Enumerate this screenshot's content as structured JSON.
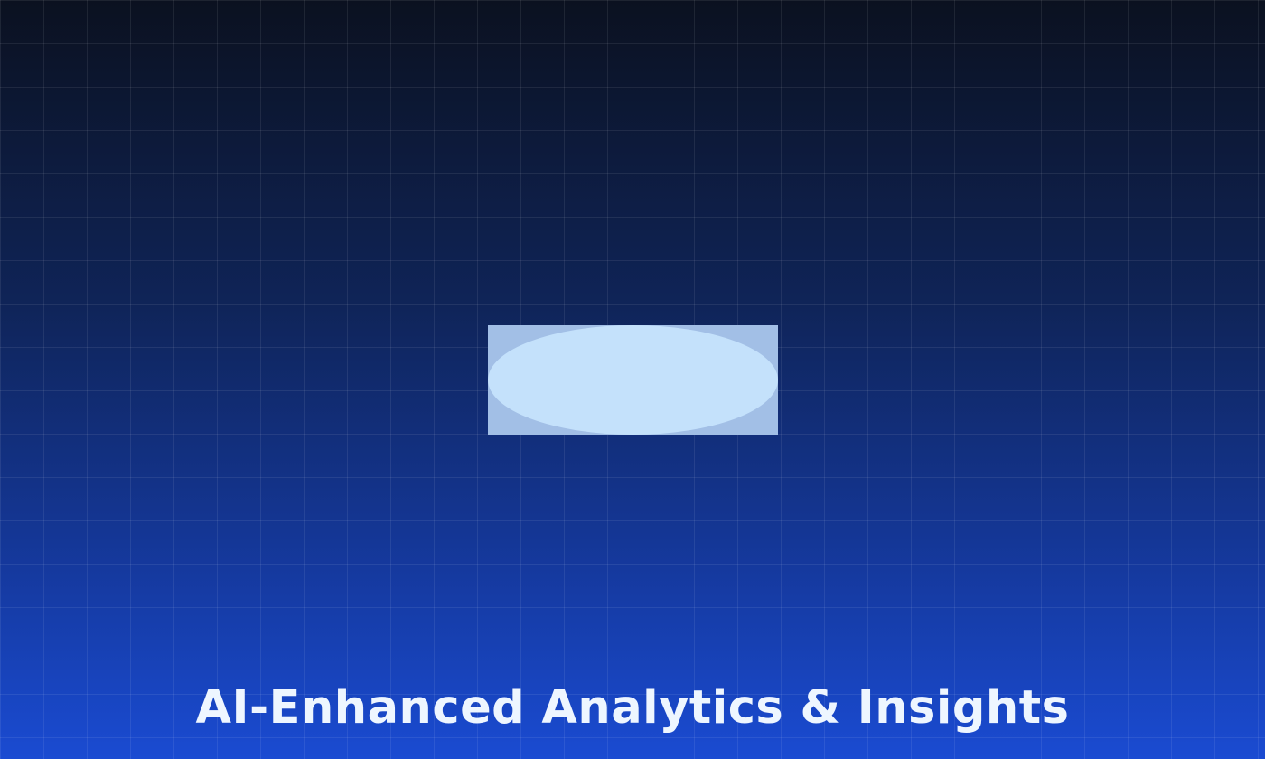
{
  "page": {
    "title": "AI-Enhanced Analytics & Insights"
  },
  "colors": {
    "background_top": "#0b1120",
    "background_bottom": "#1a4bd2",
    "graphic_frame": "#a2bfe6",
    "graphic_ellipse": "#c4e1fb",
    "title_text": "#eef6ff"
  }
}
